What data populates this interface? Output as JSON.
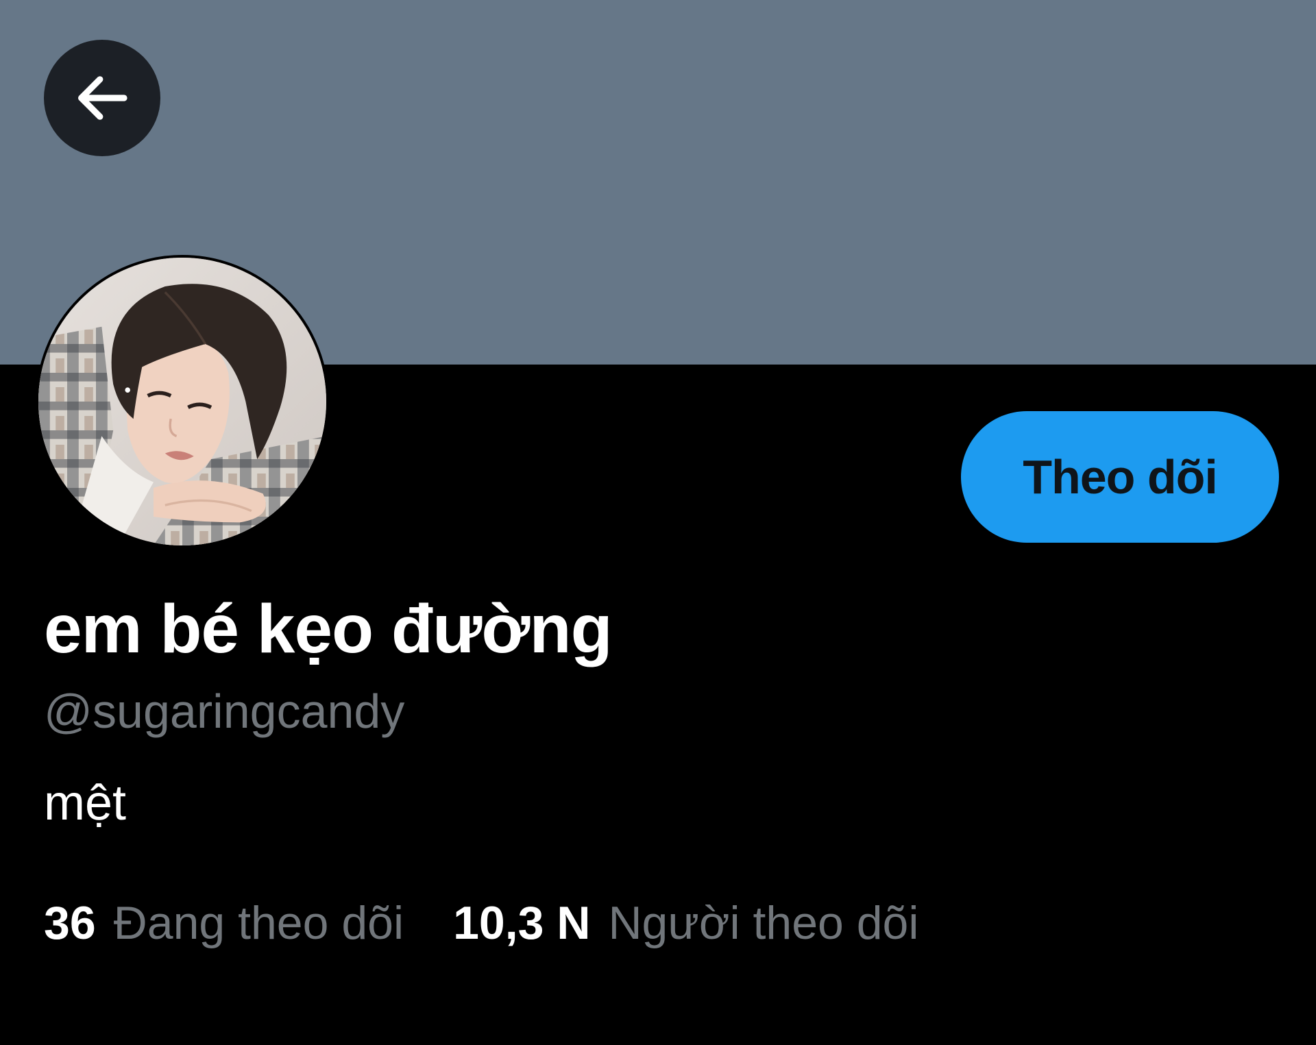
{
  "header": {
    "back_icon": "arrow-left-icon",
    "banner_color": "#667788"
  },
  "profile": {
    "display_name": "em bé kẹo đường",
    "username": "@sugaringcandy",
    "bio": "mệt",
    "avatar_icon": "profile-avatar"
  },
  "actions": {
    "follow_label": "Theo dõi",
    "follow_color": "#1d9bf0"
  },
  "stats": {
    "following_count": "36",
    "following_label": "Đang theo dõi",
    "followers_count": "10,3 N",
    "followers_label": "Người theo dõi"
  }
}
